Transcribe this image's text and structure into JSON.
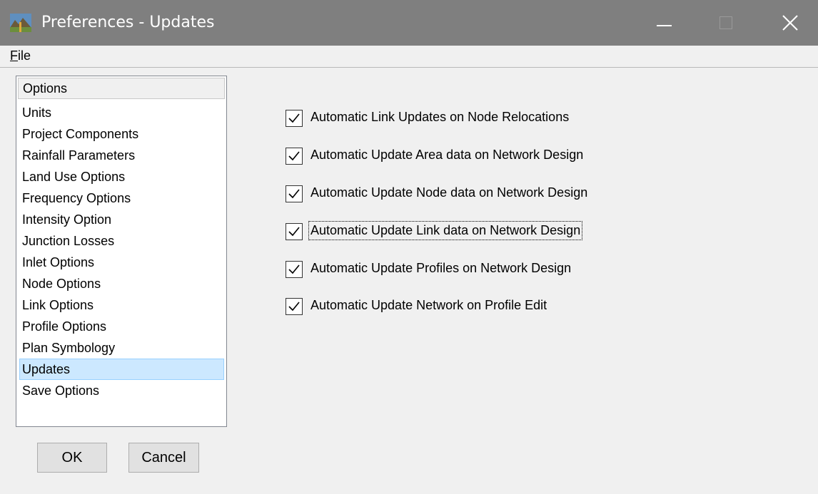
{
  "window": {
    "title": "Preferences - Updates",
    "icon": "landscape-app-icon",
    "controls": [
      "minimize-icon",
      "maximize-icon",
      "close-icon"
    ]
  },
  "menubar": {
    "file_accel": "F",
    "file_rest": "ile"
  },
  "options": {
    "header": "Options",
    "items": [
      "Units",
      "Project Components",
      "Rainfall Parameters",
      "Land Use Options",
      "Frequency Options",
      "Intensity Option",
      "Junction Losses",
      "Inlet Options",
      "Node Options",
      "Link Options",
      "Profile Options",
      "Plan Symbology",
      "Updates",
      "Save Options"
    ],
    "selected": "Updates"
  },
  "updates": {
    "checkboxes": [
      {
        "label": "Automatic Link Updates on Node Relocations",
        "checked": true
      },
      {
        "label": "Automatic Update Area data on Network Design",
        "checked": true
      },
      {
        "label": "Automatic Update Node data on Network Design",
        "checked": true
      },
      {
        "label": "Automatic Update Link data on Network Design",
        "checked": true,
        "focused": true
      },
      {
        "label": "Automatic Update Profiles on Network Design",
        "checked": true
      },
      {
        "label": "Automatic Update Network on Profile Edit",
        "checked": true
      }
    ]
  },
  "buttons": {
    "ok": "OK",
    "cancel": "Cancel"
  },
  "colors": {
    "titlebar": "#7f7f7f",
    "selection": "#cce8ff",
    "background": "#f0f0f0"
  }
}
